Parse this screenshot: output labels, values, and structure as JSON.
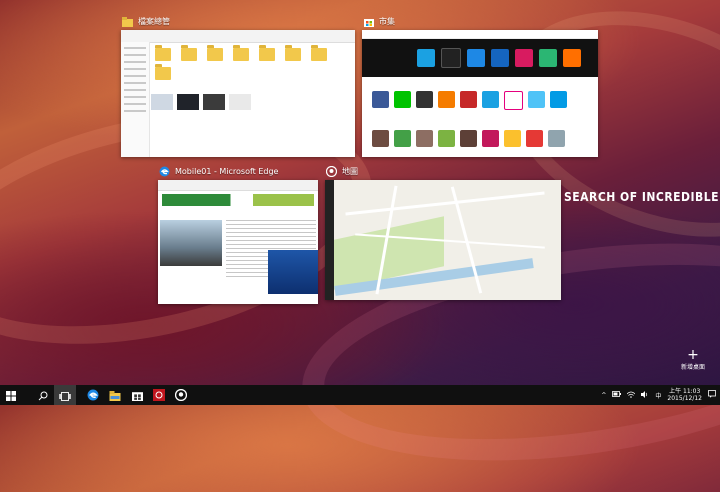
{
  "windows": [
    {
      "title": "檔案總管",
      "icon": "folder-icon"
    },
    {
      "title": "市集",
      "icon": "store-icon"
    },
    {
      "title": "Mobile01 - Microsoft Edge",
      "icon": "edge-icon"
    },
    {
      "title": "地圖",
      "icon": "maps-icon"
    }
  ],
  "overlay_text": "SEARCH OF INCREDIBLE",
  "new_desktop": {
    "label": "新增桌面",
    "icon": "plus-icon"
  },
  "taskbar": {
    "apps": [
      "start-icon",
      "search-icon",
      "task-view-icon",
      "edge-icon",
      "file-explorer-icon",
      "store-icon",
      "media-icon",
      "maps-icon"
    ],
    "tray": {
      "ime": "中",
      "time": "上午 11:03",
      "date": "2015/12/12"
    }
  },
  "colors": {
    "taskbar": "#101010",
    "accent": "#0078d7"
  }
}
